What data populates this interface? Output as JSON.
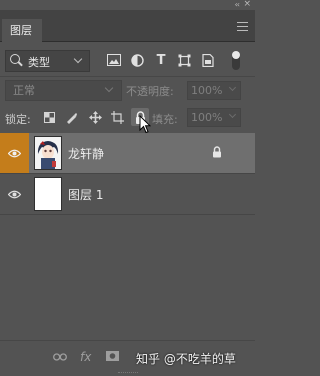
{
  "panel": {
    "tab_label": "图层",
    "collapse_glyph": "‹‹",
    "close_glyph": "×"
  },
  "filter": {
    "kind_label": "类型",
    "icons": [
      "image-filter-icon",
      "adjustment-filter-icon",
      "type-filter-icon",
      "shape-filter-icon",
      "smart-object-filter-icon"
    ],
    "type_glyph": "T"
  },
  "blend": {
    "mode": "正常",
    "opacity_label": "不透明度:",
    "opacity_value": "100%"
  },
  "lock": {
    "label": "锁定:",
    "fill_label": "填充:",
    "fill_value": "100%"
  },
  "layers": [
    {
      "name": "龙轩静",
      "selected": true,
      "locked": true,
      "visible": true
    },
    {
      "name": "图层 1",
      "selected": false,
      "locked": false,
      "visible": true
    }
  ],
  "bottom": {
    "fx_label": "fx",
    "watermark": "知乎 @不吃羊的草"
  },
  "colors": {
    "panel_bg": "#535353",
    "selected_row": "#6f6f6f",
    "eye_highlight": "#c47d1b"
  }
}
